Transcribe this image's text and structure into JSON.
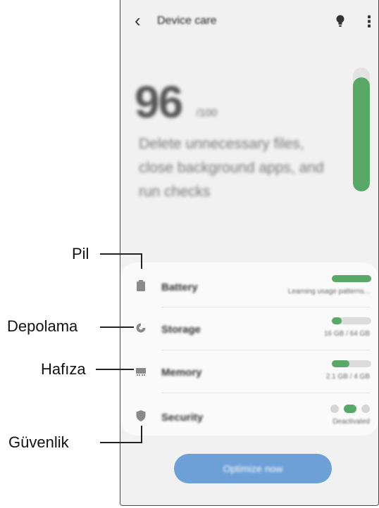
{
  "app": {
    "title": "Device care",
    "back_icon": "chevron-left-icon",
    "tips_icon": "lightbulb-icon",
    "more_icon": "more-vertical-icon"
  },
  "summary": {
    "score": "96",
    "score_unit": "/100",
    "description": "Delete unnecessary files, close background apps, and run checks",
    "gauge_level": 0.92
  },
  "items": [
    {
      "name": "Battery",
      "status": "Learning usage patterns...",
      "icon": "battery-icon",
      "level": 1.0
    },
    {
      "name": "Storage",
      "status": "16 GB / 64 GB",
      "icon": "storage-icon",
      "level": 0.25
    },
    {
      "name": "Memory",
      "status": "2.1 GB / 4 GB",
      "icon": "memory-icon",
      "level": 0.45
    },
    {
      "name": "Security",
      "status": "Deactivated",
      "icon": "shield-icon"
    }
  ],
  "optimize_button": {
    "label": "Optimize now"
  },
  "callouts": [
    {
      "label": "Pil"
    },
    {
      "label": "Depolama"
    },
    {
      "label": "Hafıza"
    },
    {
      "label": "Güvenlik"
    }
  ],
  "colors": {
    "accent_green": "#58a868",
    "button_blue": "#6ea0d8",
    "background": "#f1f1f1",
    "card": "#fafafa"
  }
}
